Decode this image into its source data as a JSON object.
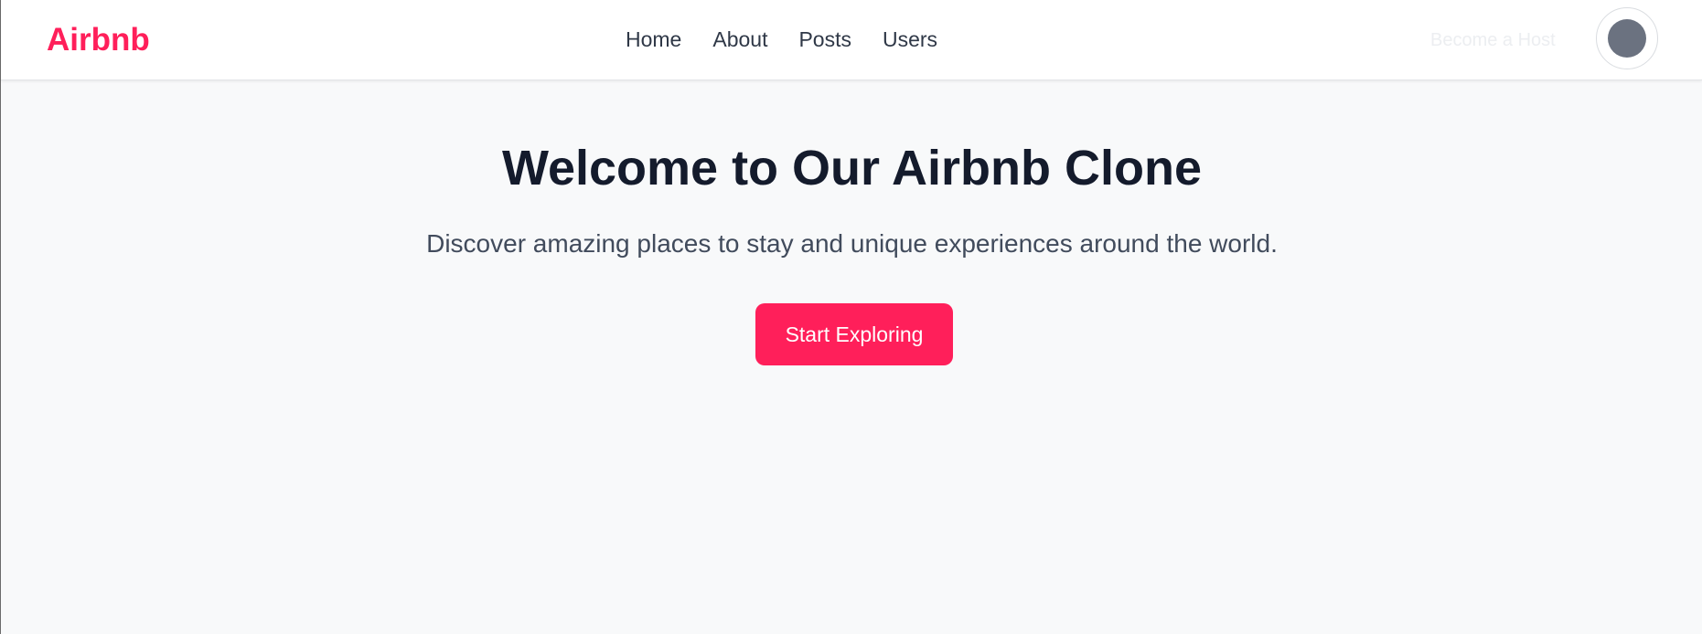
{
  "header": {
    "logo": "Airbnb",
    "nav": [
      {
        "label": "Home"
      },
      {
        "label": "About"
      },
      {
        "label": "Posts"
      },
      {
        "label": "Users"
      }
    ],
    "host_label": "Become a Host"
  },
  "hero": {
    "title": "Welcome to Our Airbnb Clone",
    "subtitle": "Discover amazing places to stay and unique experiences around the world.",
    "cta_label": "Start Exploring"
  },
  "colors": {
    "brand": "#ff1f5a",
    "text_dark": "#141b2c",
    "text_muted": "#414b5c",
    "background": "#f8f9fa",
    "avatar": "#6b7280"
  },
  "icons": {
    "avatar": "user-avatar-icon"
  }
}
